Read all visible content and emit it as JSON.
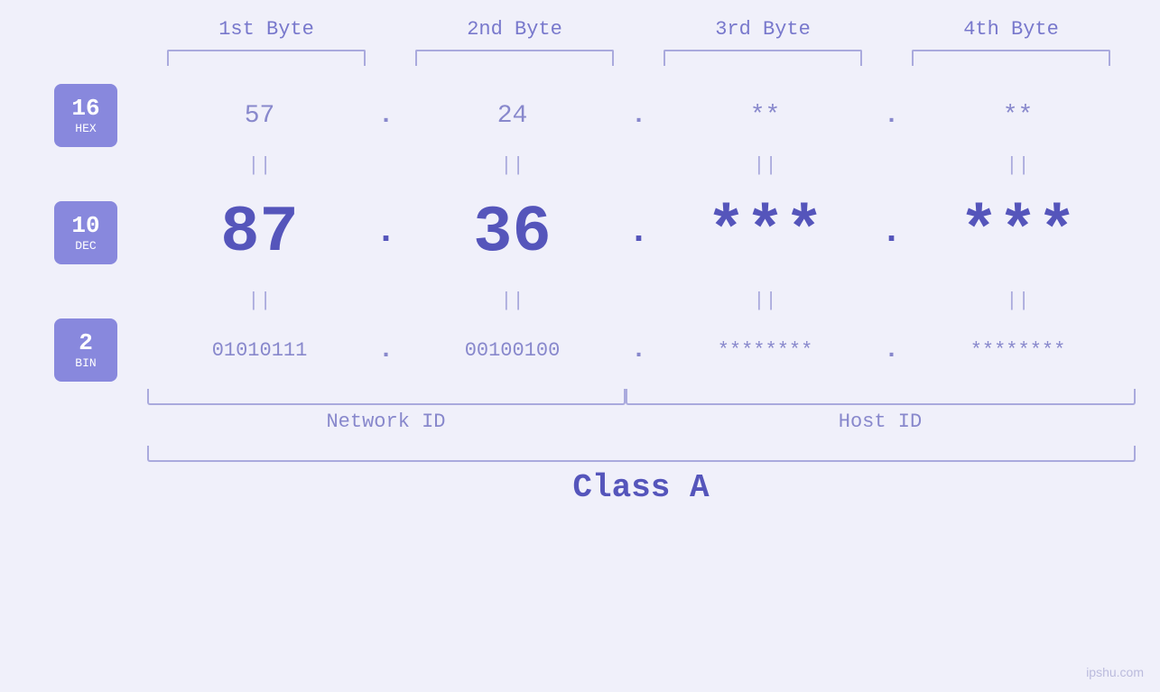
{
  "header": {
    "byte1": "1st Byte",
    "byte2": "2nd Byte",
    "byte3": "3rd Byte",
    "byte4": "4th Byte"
  },
  "badges": {
    "hex": {
      "number": "16",
      "label": "HEX"
    },
    "dec": {
      "number": "10",
      "label": "DEC"
    },
    "bin": {
      "number": "2",
      "label": "BIN"
    }
  },
  "rows": {
    "hex": {
      "b1": "57",
      "dot1": ".",
      "b2": "24",
      "dot2": ".",
      "b3": "**",
      "dot3": ".",
      "b4": "**"
    },
    "sep": {
      "v": "||"
    },
    "dec": {
      "b1": "87",
      "dot1": ".",
      "b2": "36",
      "dot2": ".",
      "b3": "***",
      "dot3": ".",
      "b4": "***"
    },
    "bin": {
      "b1": "01010111",
      "dot1": ".",
      "b2": "00100100",
      "dot2": ".",
      "b3": "********",
      "dot3": ".",
      "b4": "********"
    }
  },
  "labels": {
    "network_id": "Network ID",
    "host_id": "Host ID",
    "class": "Class A"
  },
  "watermark": "ipshu.com"
}
